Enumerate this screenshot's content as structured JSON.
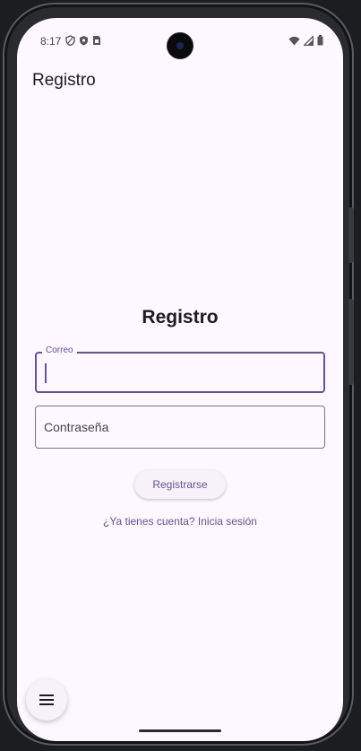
{
  "status_bar": {
    "time": "8:17",
    "left_icons": [
      "vpn-shield-icon",
      "shield-icon",
      "sim-card-icon"
    ],
    "right_icons": [
      "wifi-icon",
      "cellular-signal-icon",
      "battery-icon"
    ]
  },
  "app_bar": {
    "title": "Registro"
  },
  "form": {
    "title": "Registro",
    "email": {
      "label": "Correo",
      "value": ""
    },
    "password": {
      "placeholder": "Contraseña",
      "value": ""
    },
    "submit_label": "Registrarse",
    "login_link": "¿Ya tienes cuenta? Inicia sesión"
  },
  "fab": {
    "icon": "menu-icon"
  },
  "colors": {
    "background": "#fdf7ff",
    "primary": "#65558f",
    "outline": "#79747e",
    "text": "#1d1b20"
  }
}
